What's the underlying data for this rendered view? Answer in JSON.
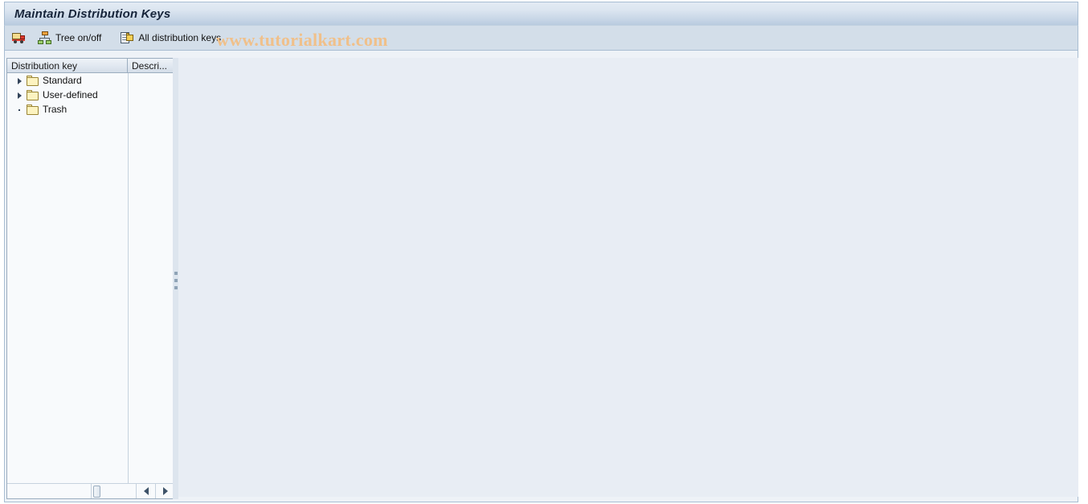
{
  "window": {
    "title": "Maintain Distribution Keys"
  },
  "toolbar": {
    "buttons": [
      {
        "label": "",
        "icon": "truck-icon",
        "name": "delivery-truck-button"
      },
      {
        "label": "Tree on/off",
        "icon": "hierarchy-icon",
        "name": "tree-on-off-button"
      },
      {
        "label": "All distribution keys",
        "icon": "all-documents-icon",
        "name": "all-distribution-keys-button"
      }
    ],
    "truck_label": "",
    "tree_label": "Tree on/off",
    "all_keys_label": "All distribution keys"
  },
  "watermark": {
    "text": "www.tutorialkart.com",
    "color": "#f0c08a"
  },
  "tree": {
    "columns": [
      {
        "label": "Distribution key",
        "name": "column-distribution-key"
      },
      {
        "label": "Descri...",
        "name": "column-description"
      }
    ],
    "col_key_label": "Distribution key",
    "col_desc_label": "Descri...",
    "nodes": [
      {
        "label": "Standard",
        "state": "collapsed",
        "icon": "folder-icon"
      },
      {
        "label": "User-defined",
        "state": "collapsed",
        "icon": "folder-icon"
      },
      {
        "label": "Trash",
        "state": "leaf",
        "icon": "folder-icon"
      }
    ]
  },
  "scrollbar": {
    "left_arrow": "◀",
    "right_arrow": "▶"
  },
  "colors": {
    "title_bar_top": "#e3ebf4",
    "title_bar_bottom": "#b9cbdf",
    "toolbar_bg": "#d3dee9",
    "content_bg": "#e8edf4",
    "tree_bg": "#f8fafc",
    "border": "#a8bdd2",
    "folder_fill": "#fdf3c0",
    "title_text": "#16243a"
  }
}
